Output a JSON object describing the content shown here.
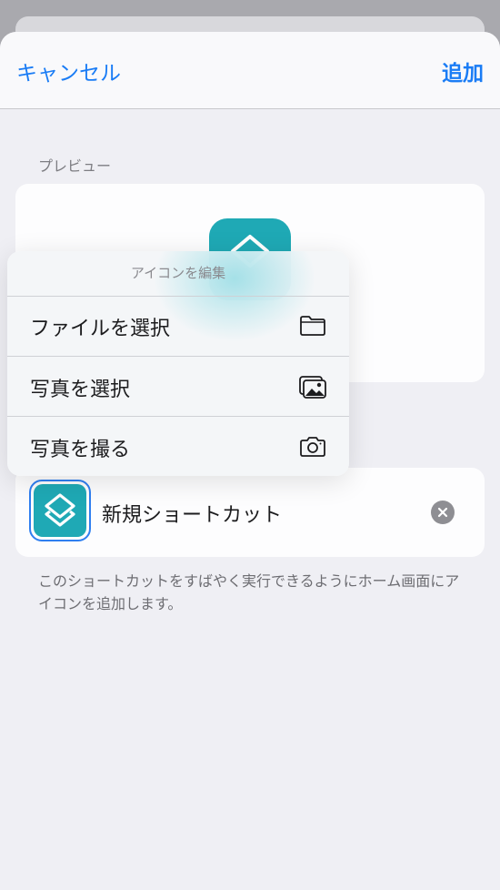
{
  "nav": {
    "cancel": "キャンセル",
    "add": "追加"
  },
  "preview": {
    "section_label": "プレビュー"
  },
  "shortcut": {
    "name": "新規ショートカット"
  },
  "description": "このショートカットをすばやく実行できるようにホーム画面にアイコンを追加します。",
  "menu": {
    "title": "アイコンを編集",
    "items": [
      {
        "label": "ファイルを選択",
        "icon": "folder-icon"
      },
      {
        "label": "写真を選択",
        "icon": "photos-icon"
      },
      {
        "label": "写真を撮る",
        "icon": "camera-icon"
      }
    ]
  },
  "colors": {
    "accent": "#1a7cf5",
    "shortcut_icon": "#1fa9b5"
  }
}
